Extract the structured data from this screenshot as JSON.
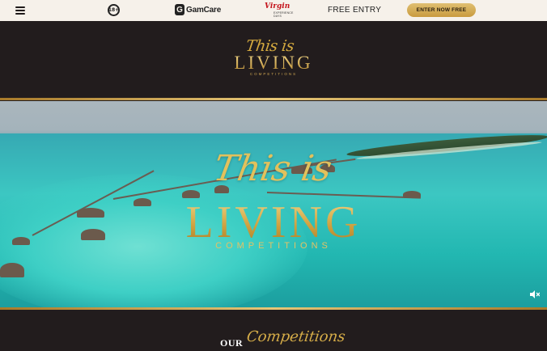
{
  "topbar": {
    "age_label": "18+",
    "gamcare_mark": "G",
    "gamcare_label": "GamCare",
    "virgin_label": "Virgin",
    "virgin_sub": "EXPERIENCE DAYS",
    "free_entry": "FREE ENTRY",
    "enter_button": "ENTER NOW FREE"
  },
  "logo": {
    "line1": "This is",
    "line2": "LIVING",
    "line3": "COMPETITIONS"
  },
  "hero": {
    "line1": "This is",
    "line2": "LIVING",
    "line3": "COMPETITIONS"
  },
  "section": {
    "our": "OUR",
    "competitions": "Competitions"
  },
  "colors": {
    "background": "#221c1d",
    "topbar": "#f6f1ea",
    "gold": "#d4a93f"
  }
}
